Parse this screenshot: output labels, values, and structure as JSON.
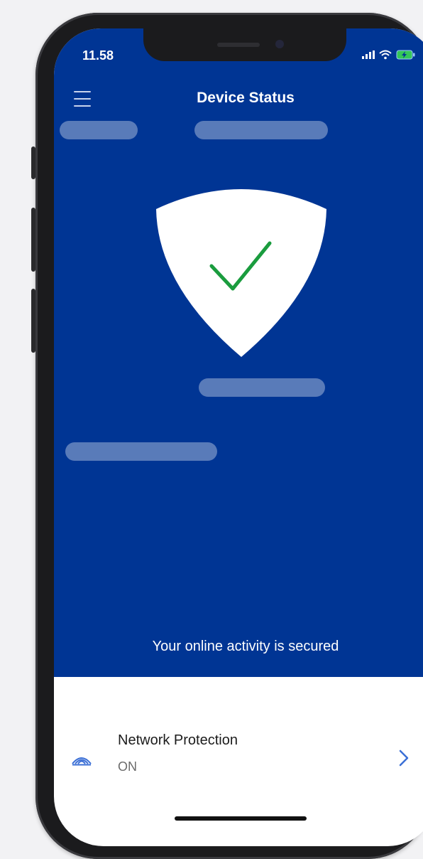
{
  "status_bar": {
    "time": "11.58",
    "icons": [
      "signal-icon",
      "wifi-icon",
      "battery-charging-icon"
    ]
  },
  "header": {
    "title": "Device Status",
    "menu_icon": "hamburger-menu-icon"
  },
  "hero": {
    "icon": "shield-check-icon",
    "message": "Your online activity is secured"
  },
  "features": [
    {
      "title": "Network Protection",
      "status": "ON",
      "icon": "network-waves-icon",
      "action_icon": "chevron-right-icon"
    }
  ],
  "colors": {
    "primary": "#003594",
    "check": "#1a9c3e",
    "accent": "#3b6fd6",
    "placeholder": "#6b86c4"
  }
}
